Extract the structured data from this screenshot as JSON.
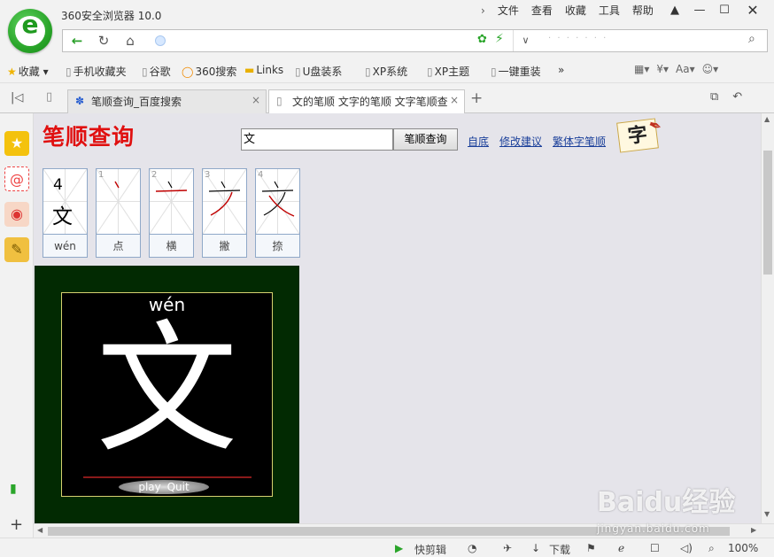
{
  "window": {
    "title": "360安全浏览器 10.0",
    "menu": [
      "文件",
      "查看",
      "收藏",
      "工具",
      "帮助"
    ],
    "controls": [
      "shirt-icon",
      "minimize-icon",
      "maximize-icon",
      "close-icon"
    ]
  },
  "address_bar": {
    "url": "",
    "search_placeholder": ""
  },
  "bookmarks": [
    {
      "label": "收藏",
      "icon": "star-icon"
    },
    {
      "label": "手机收藏夹",
      "icon": "page-icon"
    },
    {
      "label": "谷歌",
      "icon": "page-icon"
    },
    {
      "label": "360搜索",
      "icon": "ring-icon"
    },
    {
      "label": "Links",
      "icon": "folder-icon"
    },
    {
      "label": "U盘装系",
      "icon": "page-icon"
    },
    {
      "label": "XP系统",
      "icon": "page-icon"
    },
    {
      "label": "XP主题",
      "icon": "page-icon"
    },
    {
      "label": "一键重装",
      "icon": "page-icon"
    }
  ],
  "tabs": [
    {
      "label": "笔顺查询_百度搜索",
      "active": false
    },
    {
      "label": "文的笔顺 文字的笔顺 文字笔顺查",
      "active": true
    }
  ],
  "page": {
    "site_title": "笔顺查询",
    "search_value": "文",
    "search_button": "笔顺查询",
    "links": [
      "自底",
      "修改建议",
      "繁体字笔顺"
    ],
    "logo_char": "字",
    "stroke_count": "4",
    "character": "文",
    "pinyin": "wén",
    "strokes": [
      {
        "index": "1",
        "name": "点"
      },
      {
        "index": "2",
        "name": "横"
      },
      {
        "index": "3",
        "name": "撇"
      },
      {
        "index": "4",
        "name": "捺"
      }
    ],
    "animation": {
      "pinyin": "wén",
      "character": "文",
      "play_label": "play",
      "quit_label": "Quit"
    }
  },
  "status_bar": {
    "clip_label": "快剪辑",
    "download_label": "下载",
    "zoom": "100%"
  },
  "watermark": {
    "text": "Baidu经验",
    "sub": "jingyan.baidu.com"
  }
}
